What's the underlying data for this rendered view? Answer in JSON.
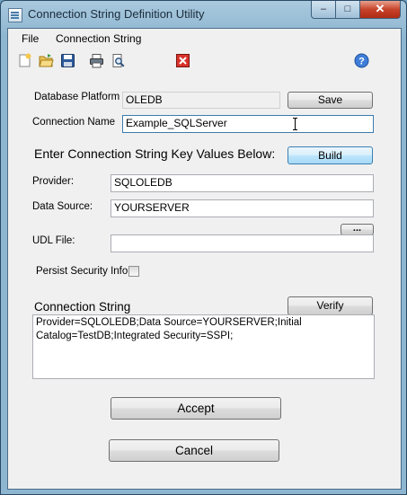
{
  "window": {
    "title": "Connection String Definition Utility"
  },
  "menu": {
    "file": "File",
    "connection_string": "Connection String"
  },
  "toolbar": {
    "icons": [
      "new-icon",
      "open-icon",
      "save-icon",
      "print-icon",
      "print-preview-icon",
      "exit-icon",
      "help-icon"
    ]
  },
  "form": {
    "database_platform_label": "Database Platform",
    "database_platform_value": "OLEDB",
    "save_button": "Save",
    "connection_name_label": "Connection Name",
    "connection_name_value": "Example_SQLServer",
    "key_values_heading": "Enter Connection String Key Values Below:",
    "build_button": "Build",
    "provider_label": "Provider:",
    "provider_value": "SQLOLEDB",
    "data_source_label": "Data Source:",
    "data_source_value": "YOURSERVER",
    "udl_file_label": "UDL File:",
    "udl_file_value": "",
    "browse_button": "...",
    "persist_security_label": "Persist Security Info",
    "persist_security_checked": false,
    "connection_string_heading": "Connection String",
    "verify_button": "Verify",
    "connection_string_value": "Provider=SQLOLEDB;Data Source=YOURSERVER;Initial Catalog=TestDB;Integrated Security=SSPI;",
    "accept_button": "Accept",
    "cancel_button": "Cancel"
  },
  "colors": {
    "title_bar": "#8eb6d0",
    "close_button": "#c7432a",
    "client_background": "#f0f0f0",
    "focus_button": "#bee6fd"
  }
}
